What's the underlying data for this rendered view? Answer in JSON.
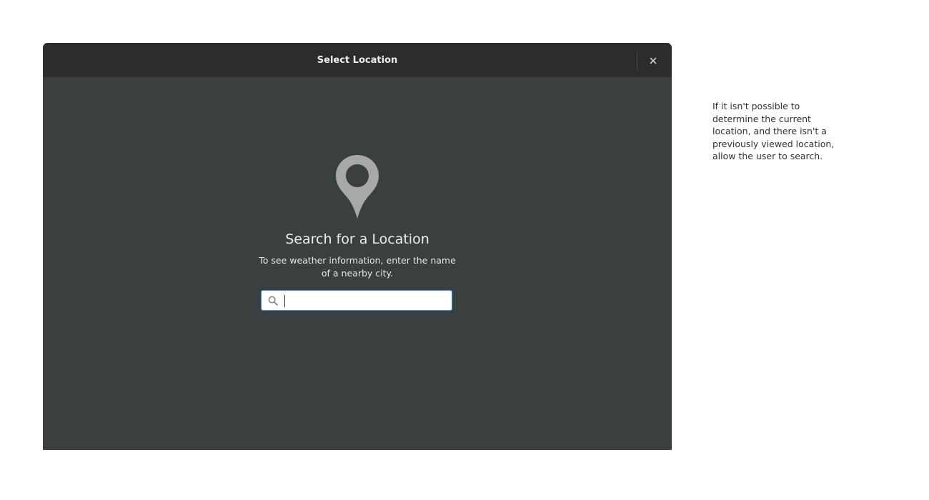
{
  "dialog": {
    "title": "Select Location",
    "close_label": "×"
  },
  "placeholder": {
    "icon": "map-pin-icon",
    "title": "Search for a Location",
    "text": "To see weather information, enter the name of a nearby city."
  },
  "search": {
    "value": "",
    "icon": "search-icon"
  },
  "annotation": {
    "text": "If it isn't possible to determine the current location, and there isn't a previously viewed location, allow the user to search."
  },
  "colors": {
    "header_bg": "#2c2c2c",
    "content_bg": "#3a3f40",
    "focus_border": "#4a90d9",
    "pin": "#a8a8a8"
  }
}
